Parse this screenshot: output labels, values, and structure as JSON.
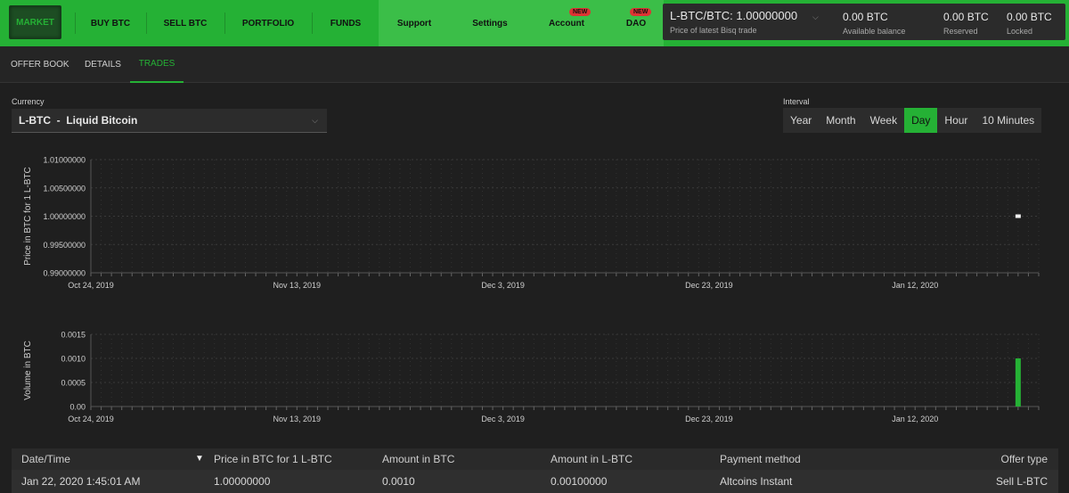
{
  "nav": {
    "market": "MARKET",
    "buy_btc": "BUY BTC",
    "sell_btc": "SELL BTC",
    "portfolio": "PORTFOLIO",
    "funds": "FUNDS",
    "support": "Support",
    "settings": "Settings",
    "account": "Account",
    "dao": "DAO",
    "new_badge": "NEW"
  },
  "balance": {
    "price": "L-BTC/BTC: 1.00000000",
    "price_sub": "Price of latest Bisq trade",
    "available": "0.00 BTC",
    "available_label": "Available balance",
    "reserved": "0.00 BTC",
    "reserved_label": "Reserved",
    "locked": "0.00 BTC",
    "locked_label": "Locked"
  },
  "tabs": [
    "OFFER BOOK",
    "DETAILS",
    "TRADES"
  ],
  "active_tab": "TRADES",
  "currency": {
    "label": "Currency",
    "value": "L-BTC  -  Liquid Bitcoin"
  },
  "interval": {
    "label": "Interval",
    "options": [
      "Year",
      "Month",
      "Week",
      "Day",
      "Hour",
      "10 Minutes"
    ],
    "selected": "Day"
  },
  "chart_data": [
    {
      "type": "scatter",
      "ylabel": "Price in BTC for 1 L-BTC",
      "yticks": [
        "1.01000000",
        "1.00500000",
        "1.00000000",
        "0.99500000",
        "0.99000000"
      ],
      "ylim": [
        0.99,
        1.01
      ],
      "xticks": [
        "Oct 24, 2019",
        "Nov 13, 2019",
        "Dec 3, 2019",
        "Dec 23, 2019",
        "Jan 12, 2020"
      ],
      "xlim": [
        "2019-10-24",
        "2020-01-24"
      ],
      "points": [
        {
          "x": "2020-01-22",
          "y": 1.0
        }
      ],
      "grid": true
    },
    {
      "type": "bar",
      "ylabel": "Volume in BTC",
      "yticks": [
        "0.0015",
        "0.0010",
        "0.0005",
        "0.00"
      ],
      "ylim": [
        0,
        0.0015
      ],
      "xticks": [
        "Oct 24, 2019",
        "Nov 13, 2019",
        "Dec 3, 2019",
        "Dec 23, 2019",
        "Jan 12, 2020"
      ],
      "xlim": [
        "2019-10-24",
        "2020-01-24"
      ],
      "bars": [
        {
          "x": "2020-01-22",
          "y": 0.001
        }
      ],
      "color": "#25b135",
      "grid": true
    }
  ],
  "table": {
    "headers": [
      "Date/Time",
      "Price in BTC for 1 L-BTC",
      "Amount in BTC",
      "Amount in L-BTC",
      "Payment method",
      "Offer type"
    ],
    "rows": [
      [
        "Jan 22, 2020 1:45:01 AM",
        "1.00000000",
        "0.0010",
        "0.00100000",
        "Altcoins Instant",
        "Sell L-BTC"
      ]
    ]
  },
  "colors": {
    "accent": "#25b135",
    "background": "#1f1f1f"
  }
}
